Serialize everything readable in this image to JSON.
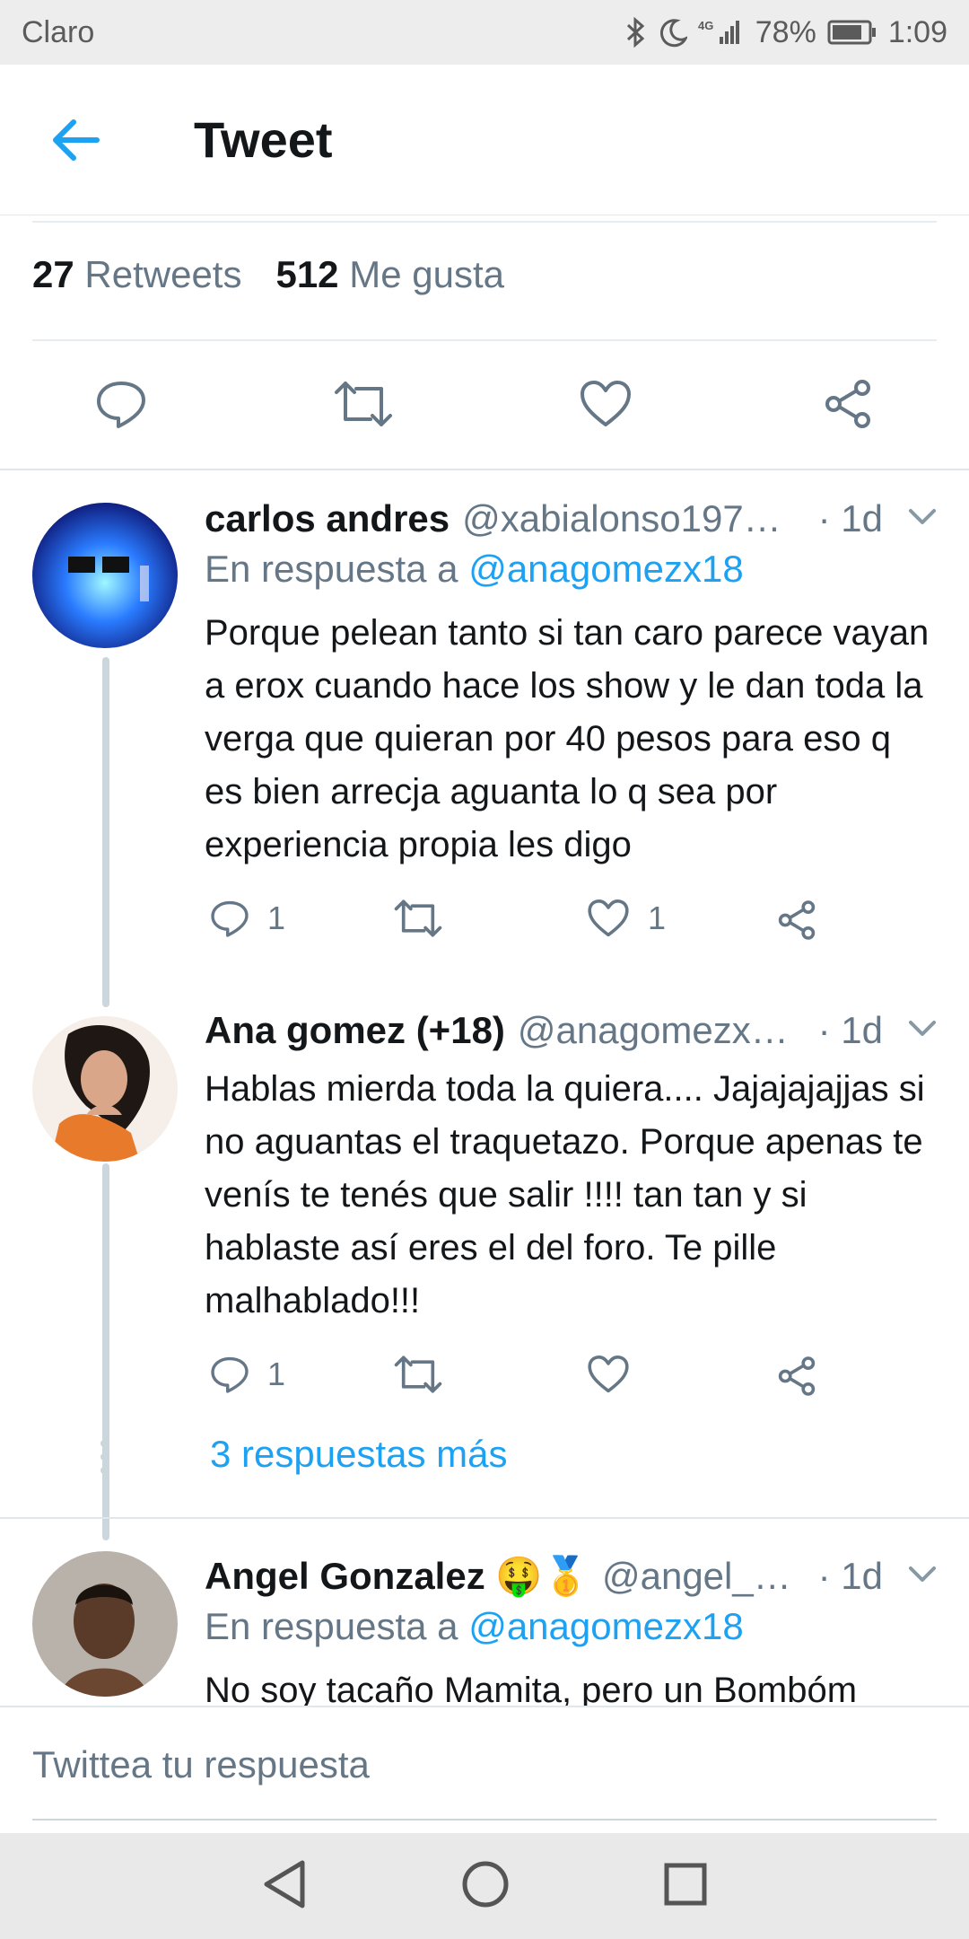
{
  "status_bar": {
    "carrier": "Claro",
    "network": "4G",
    "battery": "78%",
    "time": "1:09"
  },
  "header": {
    "title": "Tweet"
  },
  "stats": {
    "retweets_count": "27",
    "retweets_label": "Retweets",
    "likes_count": "512",
    "likes_label": "Me gusta"
  },
  "replies": [
    {
      "name": "carlos andres",
      "handle": "@xabialonso197…",
      "time": "· 1d",
      "reply_prefix": "En respuesta a",
      "reply_to": "@anagomezx18",
      "text": "Porque pelean tanto si tan caro parece vayan a erox cuando hace los show y le dan toda la verga que quieran por 40 pesos para eso q es bien arrecja aguanta lo q sea  por experiencia propia les digo",
      "reply_count": "1",
      "like_count": "1"
    },
    {
      "name": "Ana gomez (+18)",
      "handle": "@anagomezx…",
      "time": "· 1d",
      "text": "Hablas mierda toda la quiera.... Jajajajajjas si no aguantas el traquetazo. Porque apenas te venís te tenés que salir !!!! tan tan y si hablaste así eres el del foro. Te pille malhablado!!!",
      "reply_count": "1",
      "like_count": ""
    },
    {
      "name": "Angel Gonzalez 🤑🥇",
      "handle": "@angel_…",
      "time": "· 1d",
      "reply_prefix": "En respuesta a",
      "reply_to": "@anagomezx18",
      "text": "No soy tacaño Mamita, pero un Bombóm"
    }
  ],
  "more_replies": "3 respuestas más",
  "composer": {
    "placeholder": "Twittea tu respuesta"
  },
  "colors": {
    "accent": "#1da1f2",
    "secondary_text": "#657786",
    "divider": "#e1e8ed"
  }
}
